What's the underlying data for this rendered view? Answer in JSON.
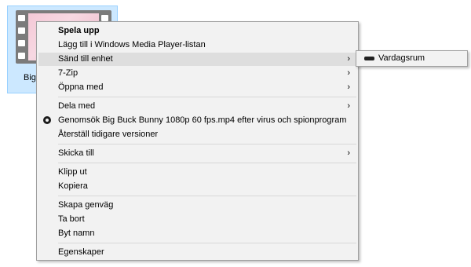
{
  "file": {
    "label": "Big"
  },
  "menu": {
    "items": [
      {
        "label": "Spela upp"
      },
      {
        "label": "Lägg till i Windows Media Player-listan"
      },
      {
        "label": "Sänd till enhet"
      },
      {
        "label": "7-Zip"
      },
      {
        "label": "Öppna med"
      },
      {
        "label": "Dela med"
      },
      {
        "label": "Genomsök Big Buck Bunny 1080p 60 fps.mp4 efter virus och spionprogram"
      },
      {
        "label": "Återställ tidigare versioner"
      },
      {
        "label": "Skicka till"
      },
      {
        "label": "Klipp ut"
      },
      {
        "label": "Kopiera"
      },
      {
        "label": "Skapa genväg"
      },
      {
        "label": "Ta bort"
      },
      {
        "label": "Byt namn"
      },
      {
        "label": "Egenskaper"
      }
    ],
    "arrow": "›"
  },
  "submenu": {
    "items": [
      {
        "label": "Vardagsrum"
      }
    ]
  }
}
